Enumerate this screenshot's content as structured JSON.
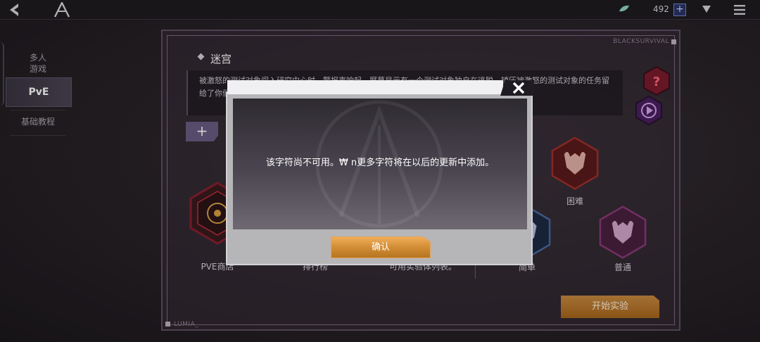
{
  "topbar": {
    "currency_amount": "492",
    "plus": "+"
  },
  "leftnav": {
    "multiplayer_line1": "多人",
    "multiplayer_line2": "游戏",
    "pve": "PvE",
    "tutorial": "基础教程"
  },
  "panel": {
    "brand_top": "BLACKSURVIVAL",
    "brand_bottom": "LUMIA_",
    "section_title": "迷宫",
    "description": "被激怒的测试对象闯入研究中心时，警报声响起。屏幕显示有一个测试对象独自在逃脱。镇压被激怒的测试对象的任务留给了你们。我们将一起探索Lumia岛的迷宫，找出阻拦我们的道路！",
    "add_label": "+",
    "modes": [
      "PVE商店",
      "排行榜",
      "可用实验体列表。"
    ],
    "difficulties": [
      "困难",
      "简单",
      "普通"
    ],
    "start_label": "开始实验",
    "help_label": "?"
  },
  "modal": {
    "message": "该字符尚不可用。₩ n更多字符将在以后的更新中添加。",
    "confirm_label": "确认"
  },
  "colors": {
    "accent_orange": "#cf8a32",
    "panel_border": "#5d5064",
    "help_red": "#8a1f32",
    "play_purple": "#5a2a72"
  }
}
